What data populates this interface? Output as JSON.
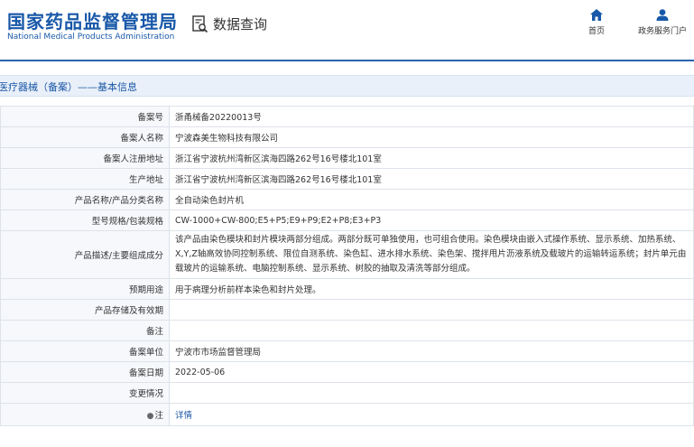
{
  "header": {
    "title": "国家药品监督管理局",
    "subtitle": "National Medical Products Administration",
    "query_label": "数据查询",
    "nav": {
      "home": "首页",
      "service": "政务服务门户"
    }
  },
  "section": {
    "title": "医疗器械（备案）——基本信息"
  },
  "rows": [
    {
      "label": "备案号",
      "value": "浙甬械备20220013号"
    },
    {
      "label": "备案人名称",
      "value": "宁波森美生物科技有限公司"
    },
    {
      "label": "备案人注册地址",
      "value": "浙江省宁波杭州湾新区滨海四路262号16号楼北101室"
    },
    {
      "label": "生产地址",
      "value": "浙江省宁波杭州湾新区滨海四路262号16号楼北101室"
    },
    {
      "label": "产品名称/产品分类名称",
      "value": "全自动染色封片机"
    },
    {
      "label": "型号规格/包装规格",
      "value": "CW-1000+CW-800;E5+P5;E9+P9;E2+P8;E3+P3"
    },
    {
      "label": "产品描述/主要组成成分",
      "value": "该产品由染色模块和封片模块两部分组成。两部分既可单独使用，也可组合使用。染色模块由嵌入式操作系统、显示系统、加热系统、X,Y,Z轴高效协同控制系统、限位自测系统、染色缸、进水排水系统、染色架、搅拌甩片沥液系统及载玻片的运输转运系统；封片单元由载玻片的运输系统、电脑控制系统、显示系统、树胶的抽取及清洗等部分组成。"
    },
    {
      "label": "预期用途",
      "value": "用于病理分析前样本染色和封片处理。"
    },
    {
      "label": "产品存储及有效期",
      "value": ""
    },
    {
      "label": "备注",
      "value": ""
    },
    {
      "label": "备案单位",
      "value": "宁波市市场监督管理局"
    },
    {
      "label": "备案日期",
      "value": "2022-05-06"
    },
    {
      "label": "变更情况",
      "value": ""
    },
    {
      "label": "注",
      "value": "详情"
    }
  ]
}
